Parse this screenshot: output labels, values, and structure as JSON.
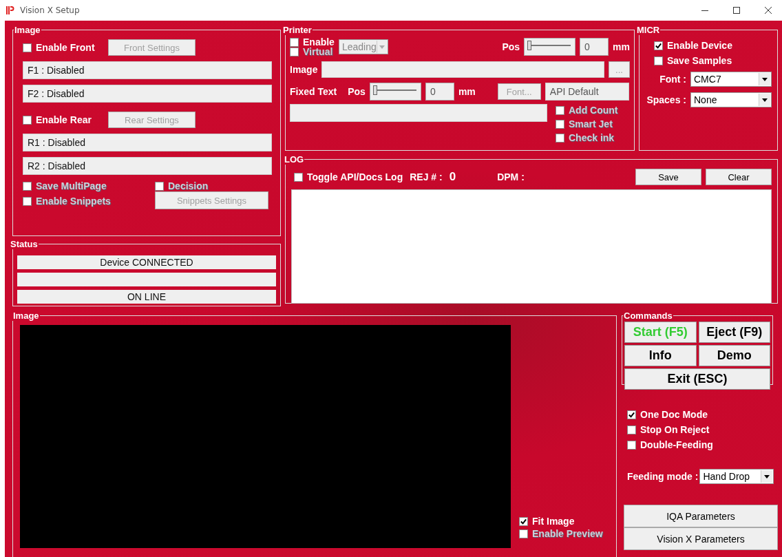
{
  "window": {
    "title": "Vision X Setup"
  },
  "image_settings": {
    "title": "Image",
    "front_enable": {
      "label": "Enable Front",
      "checked": false
    },
    "front_settings": {
      "label": "Front Settings",
      "disabled": true
    },
    "front_fields": [
      "F1 : Disabled",
      "F2 : Disabled"
    ],
    "rear_enable": {
      "label": "Enable Rear",
      "checked": false
    },
    "rear_settings": {
      "label": "Rear Settings",
      "disabled": true
    },
    "rear_fields": [
      "R1 : Disabled",
      "R2 : Disabled"
    ],
    "save_multipage": {
      "label": "Save MultiPage",
      "checked": false,
      "disabled": true
    },
    "decision": {
      "label": "Decision",
      "checked": false,
      "disabled": true
    },
    "enable_snippets": {
      "label": "Enable Snippets",
      "checked": false,
      "disabled": true
    },
    "snippets_settings": {
      "label": "Snippets Settings",
      "disabled": true
    }
  },
  "printer": {
    "title": "Printer",
    "enable": {
      "label": "Enable",
      "checked": false,
      "disabled": false
    },
    "virtual": {
      "label": "Virtual",
      "checked": false,
      "disabled": true
    },
    "mode": {
      "value": "Leading",
      "disabled": true
    },
    "pos_label": "Pos",
    "pos_slider": {
      "level": 0
    },
    "pos_value": "0",
    "pos_unit": "mm",
    "image_label": "Image",
    "browse_button": {
      "label": "...",
      "disabled": true
    },
    "fixed_text_label": "Fixed Text",
    "fixed_pos_label": "Pos",
    "fixed_pos_slider": {
      "level": 0
    },
    "fixed_pos_value": "0",
    "fixed_pos_unit": "mm",
    "font_button": {
      "label": "Font...",
      "disabled": true
    },
    "font_name": "API Default",
    "options": [
      {
        "label": "Add Count",
        "checked": false,
        "disabled": true
      },
      {
        "label": "Smart Jet",
        "checked": false,
        "disabled": true
      },
      {
        "label": "Check ink",
        "checked": false,
        "disabled": true
      }
    ]
  },
  "micr": {
    "title": "MICR",
    "options": [
      {
        "label": "Enable Device",
        "checked": true
      },
      {
        "label": "Save Samples",
        "checked": false
      }
    ],
    "font_label": "Font :",
    "font": "CMC7",
    "spaces_label": "Spaces :",
    "spaces": "None"
  },
  "log": {
    "title": "LOG",
    "toggle": {
      "label": "Toggle API/Docs Log",
      "checked": false
    },
    "rej_label": "REJ # :",
    "rej_count": "0",
    "dpm_label": "DPM :",
    "buttons": [
      "Save",
      "Clear"
    ]
  },
  "status": {
    "title": "Status",
    "lines": [
      {
        "kind": "text",
        "text": "Device CONNECTED"
      },
      {
        "kind": "blank"
      },
      {
        "kind": "text",
        "text": "ON LINE"
      }
    ]
  },
  "image_view": {
    "title": "Image",
    "options": [
      {
        "label": "Fit Image",
        "checked": true,
        "disabled": false
      },
      {
        "label": "Enable Preview",
        "checked": false,
        "disabled": true
      }
    ]
  },
  "commands": {
    "title": "Commands",
    "buttons": [
      {
        "label": "Start (F5)",
        "kind": "start"
      },
      {
        "label": "Eject (F9)",
        "kind": "normal"
      },
      {
        "label": "Info",
        "kind": "normal"
      },
      {
        "label": "Demo",
        "kind": "normal"
      },
      {
        "label": "Exit (ESC)",
        "kind": "wide"
      }
    ]
  },
  "run_options": [
    {
      "label": "One Doc Mode",
      "checked": true
    },
    {
      "label": "Stop On Reject",
      "checked": false
    },
    {
      "label": "Double-Feeding",
      "checked": false
    }
  ],
  "feeding_mode": {
    "label": "Feeding mode :",
    "value": "Hand Drop"
  },
  "parameter_buttons": [
    "IQA Parameters",
    "Vision X Parameters"
  ]
}
